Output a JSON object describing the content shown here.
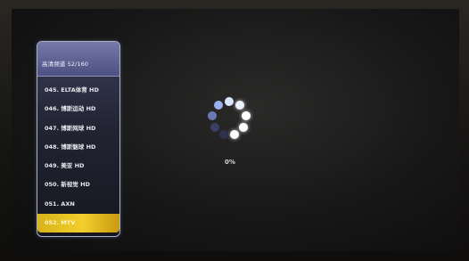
{
  "channel_panel": {
    "title": "高清频道 52/160",
    "channels": [
      {
        "label": "045. ELTA体育 HD",
        "selected": false
      },
      {
        "label": "046. 博斯运动 HD",
        "selected": false
      },
      {
        "label": "047. 博斯网球 HD",
        "selected": false
      },
      {
        "label": "048. 博斯魅球 HD",
        "selected": false
      },
      {
        "label": "049. 美亚 HD",
        "selected": false
      },
      {
        "label": "050. 新视觉 HD",
        "selected": false
      },
      {
        "label": "051. AXN",
        "selected": false
      },
      {
        "label": "052. MTV",
        "selected": true
      }
    ]
  },
  "loading": {
    "progress_text": "0%",
    "progress_percent": 0,
    "spinner_colors": [
      "#d9e4ff",
      "#eaf1ff",
      "#ffffff",
      "#ffffff",
      "#ffffff",
      "#2e3250",
      "#3a3f65",
      "#6a78b8",
      "#98b2ee"
    ]
  },
  "colors": {
    "panel_border": "#aab0c8",
    "selected_highlight": "#e8c126"
  }
}
